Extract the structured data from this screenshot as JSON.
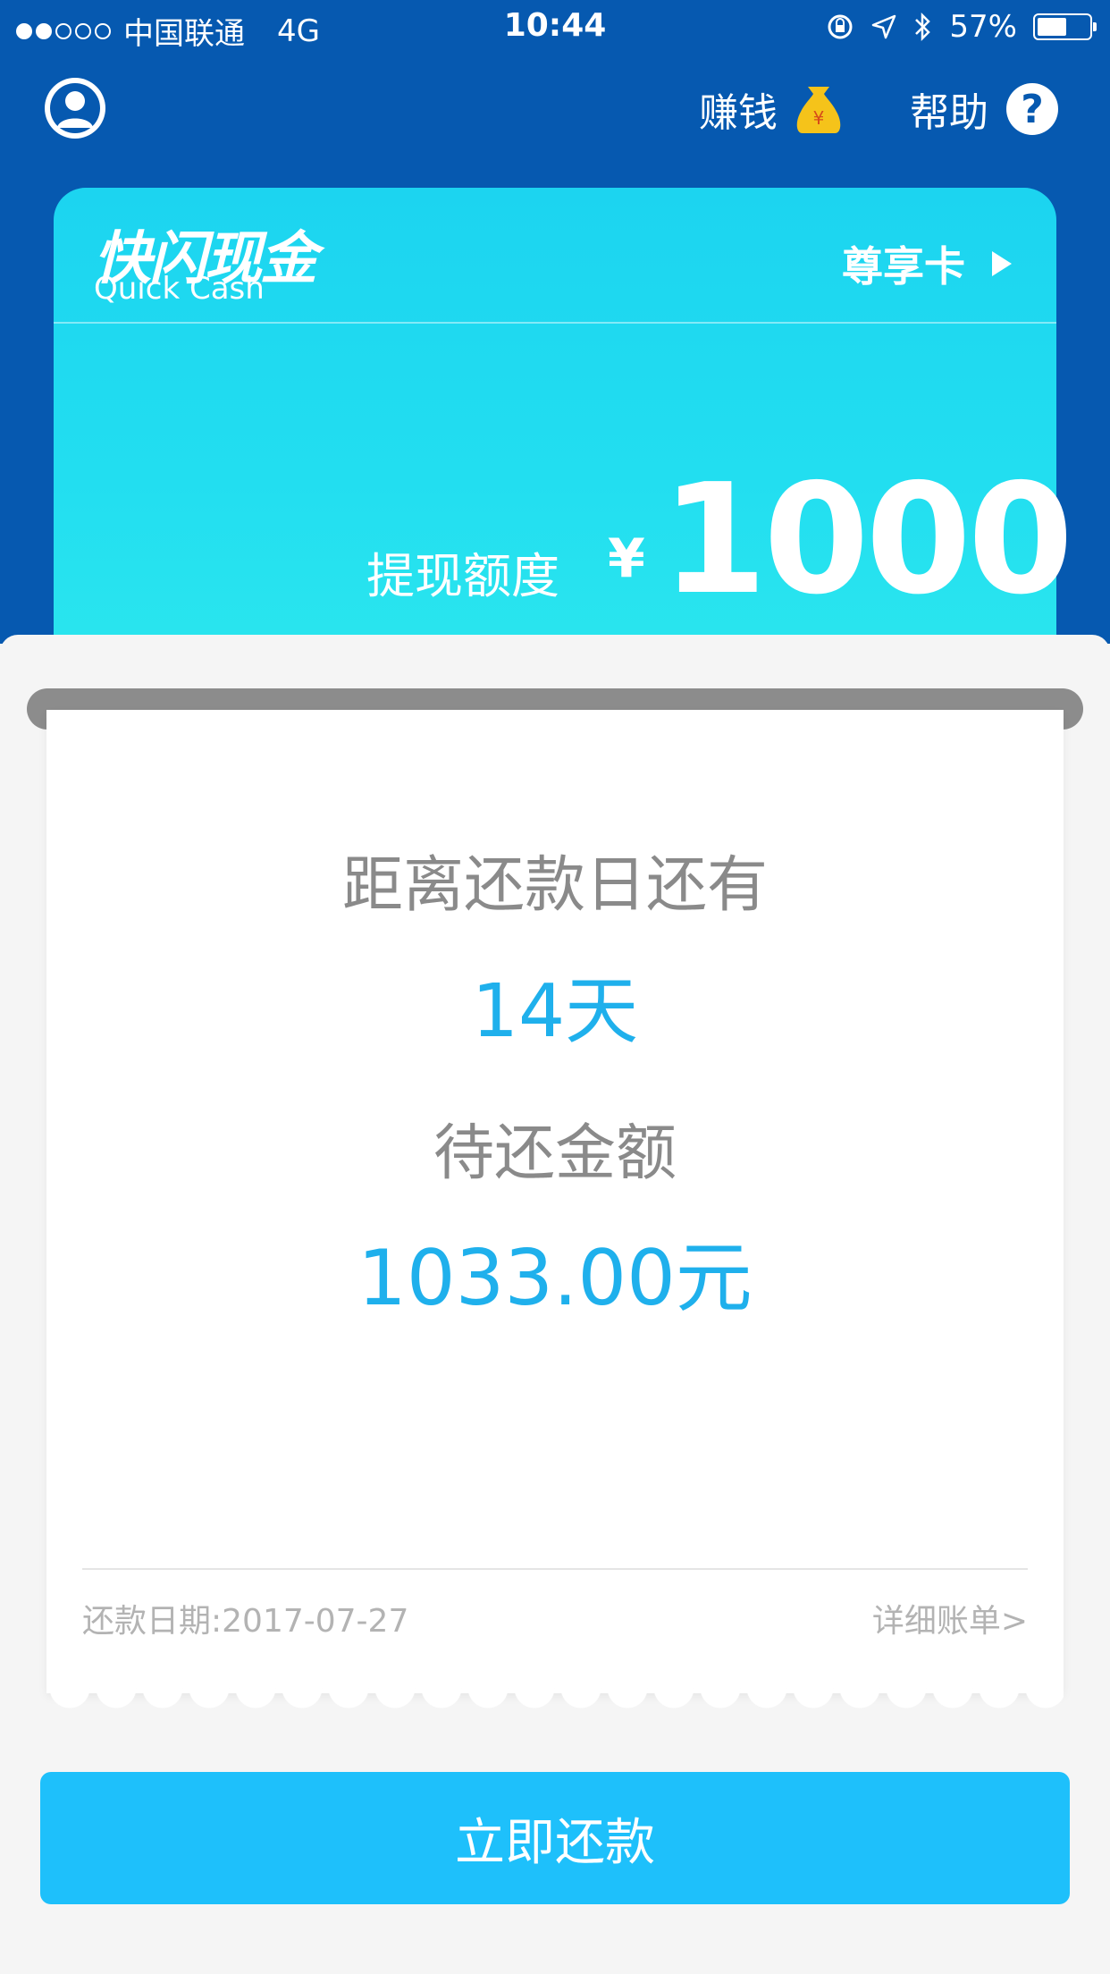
{
  "status_bar": {
    "carrier": "中国联通",
    "network": "4G",
    "time": "10:44",
    "battery": "57%",
    "battery_level": 0.57
  },
  "header": {
    "earn_label": "赚钱",
    "help_label": "帮助",
    "help_icon_glyph": "?"
  },
  "card": {
    "brand_cn": "快闪现金",
    "brand_en": "Quick Cash",
    "vip_label": "尊享卡",
    "limit_label": "提现额度",
    "currency": "¥",
    "limit_amount": "1000"
  },
  "receipt": {
    "days_label": "距离还款日还有",
    "days_value": "14天",
    "amount_label": "待还金额",
    "amount_value": "1033.00元",
    "due_date": "还款日期:2017-07-27",
    "detail_link": "详细账单>"
  },
  "action": {
    "pay_label": "立即还款"
  },
  "colors": {
    "header_bg": "#0659b0",
    "card_bg": "#22def0",
    "accent": "#1fb0ec",
    "button_bg": "#1ec0fb"
  }
}
